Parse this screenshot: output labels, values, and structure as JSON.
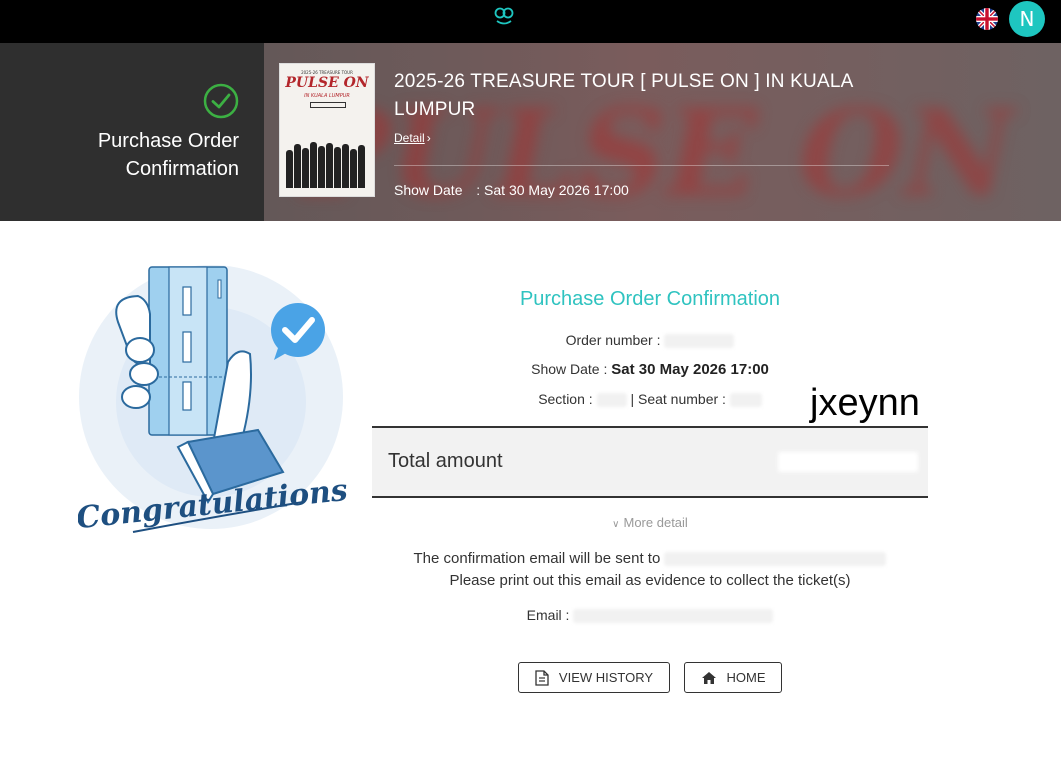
{
  "header": {
    "logo_icon": "brand-logo-icon",
    "language_flag": "uk-flag-icon",
    "avatar_initial": "N",
    "avatar_color": "#1ec6c0"
  },
  "banner": {
    "status_icon": "check-circle-icon",
    "page_title": "Purchase Order Confirmation",
    "poster": {
      "top_text": "2025-26 TREASURE TOUR",
      "title": "PULSE ON",
      "subtitle": "IN KUALA LUMPUR"
    },
    "event_title": "2025-26 TREASURE TOUR [ PULSE ON ] IN KUALA LUMPUR",
    "detail_link": "Detail",
    "show_date_label": "Show Date",
    "show_date_value": ": Sat 30 May 2026 17:00"
  },
  "illustration": {
    "caption": "Congratulations",
    "icon": "ticket-in-hand-icon"
  },
  "confirmation": {
    "title": "Purchase Order Confirmation",
    "title_color": "#2fc3c0",
    "order_number_label": "Order number :",
    "show_date_label": "Show Date :",
    "show_date_value": "Sat 30 May 2026 17:00",
    "section_label": "Section :",
    "seat_number_label": "| Seat number :",
    "total_amount_label": "Total amount",
    "more_detail_label": "More detail",
    "email_notice": "The confirmation email will be sent to",
    "print_notice": "Please print out this email as evidence to collect the ticket(s)",
    "email_label": "Email :",
    "watermark": "jxeynn"
  },
  "actions": {
    "view_history_label": "VIEW HISTORY",
    "home_label": "HOME"
  }
}
